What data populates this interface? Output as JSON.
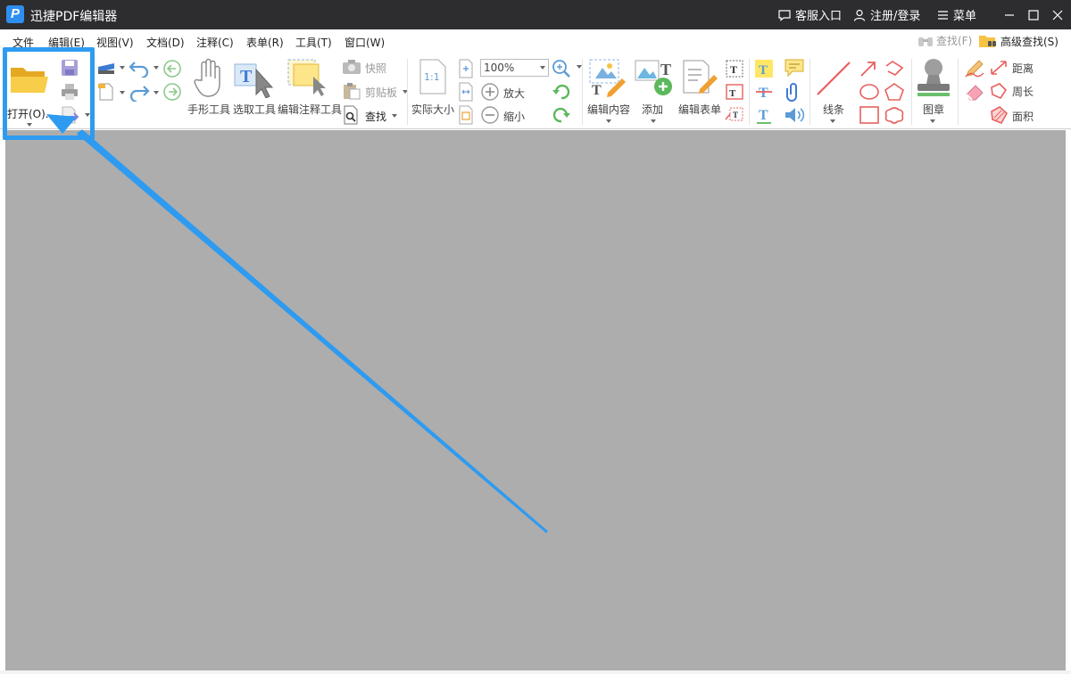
{
  "app": {
    "title": "迅捷PDF编辑器",
    "logo_letter": "P"
  },
  "titlebar": {
    "service_label": "客服入口",
    "login_label": "注册/登录",
    "menu_label": "菜单"
  },
  "menu": {
    "items": [
      "文件",
      "编辑(E)",
      "视图(V)",
      "文档(D)",
      "注释(C)",
      "表单(R)",
      "工具(T)",
      "窗口(W)"
    ],
    "find_label": "查找(F)",
    "advanced_find_label": "高级查找(S)"
  },
  "ribbon": {
    "open_label": "打开(O)...",
    "hand_tool": "手形工具",
    "select_tool": "选取工具",
    "edit_annot_tool": "编辑注释工具",
    "snapshot": "快照",
    "clipboard": "剪贴板",
    "find": "查找",
    "actual_size": "实际大小",
    "actual_size_glyph": "1:1",
    "zoom_value": "100%",
    "zoom_in": "放大",
    "zoom_out": "缩小",
    "edit_content": "编辑内容",
    "add": "添加",
    "edit_form": "编辑表单",
    "lines": "线条",
    "stamp": "图章",
    "distance": "距离",
    "perimeter": "周长",
    "area": "面积"
  },
  "colors": {
    "titlebar_bg": "#2d2d30",
    "accent_blue": "#2e9bf0",
    "doc_bg": "#adadad",
    "shape_red": "#e8605f",
    "icon_green": "#5cb85c",
    "icon_blue": "#5b9bd5"
  }
}
